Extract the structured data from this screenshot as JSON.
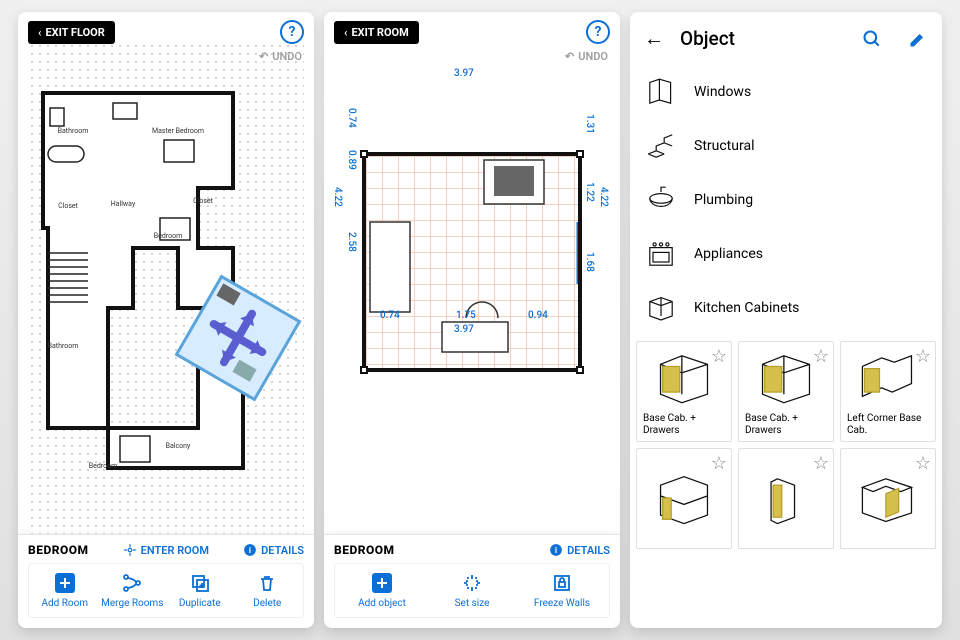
{
  "panel1": {
    "exit_label": "EXIT FLOOR",
    "undo_label": "UNDO",
    "room_title": "BEDROOM",
    "enter_room": "ENTER ROOM",
    "details": "DETAILS",
    "actions": [
      {
        "label": "Add Room"
      },
      {
        "label": "Merge Rooms"
      },
      {
        "label": "Duplicate"
      },
      {
        "label": "Delete"
      }
    ],
    "rooms": [
      "Bathroom",
      "Master Bedroom",
      "Closet",
      "Hallway",
      "Closet",
      "Bedroom",
      "Bathroom",
      "Bedroom",
      "Balcony"
    ]
  },
  "panel2": {
    "exit_label": "EXIT ROOM",
    "undo_label": "UNDO",
    "room_title": "BEDROOM",
    "details": "DETAILS",
    "dimensions": {
      "top_width": "3.97",
      "bottom_width": "3.97",
      "left_segments": [
        "0.74",
        "0.89",
        "2.58"
      ],
      "left_total": "4.22",
      "right_segments": [
        "1.31",
        "1.22",
        "1.68"
      ],
      "right_total": "4.22",
      "bottom_segments": [
        "0.74",
        "1.75",
        "0.94"
      ]
    },
    "actions": [
      {
        "label": "Add object"
      },
      {
        "label": "Set size"
      },
      {
        "label": "Freeze Walls"
      }
    ]
  },
  "panel3": {
    "title": "Object",
    "categories": [
      {
        "name": "Windows"
      },
      {
        "name": "Structural"
      },
      {
        "name": "Plumbing"
      },
      {
        "name": "Appliances"
      },
      {
        "name": "Kitchen Cabinets"
      }
    ],
    "items": [
      {
        "name": "Base Cab. + Drawers"
      },
      {
        "name": "Base Cab. + Drawers"
      },
      {
        "name": "Left Corner Base Cab."
      },
      {
        "name": ""
      },
      {
        "name": ""
      },
      {
        "name": ""
      }
    ]
  }
}
